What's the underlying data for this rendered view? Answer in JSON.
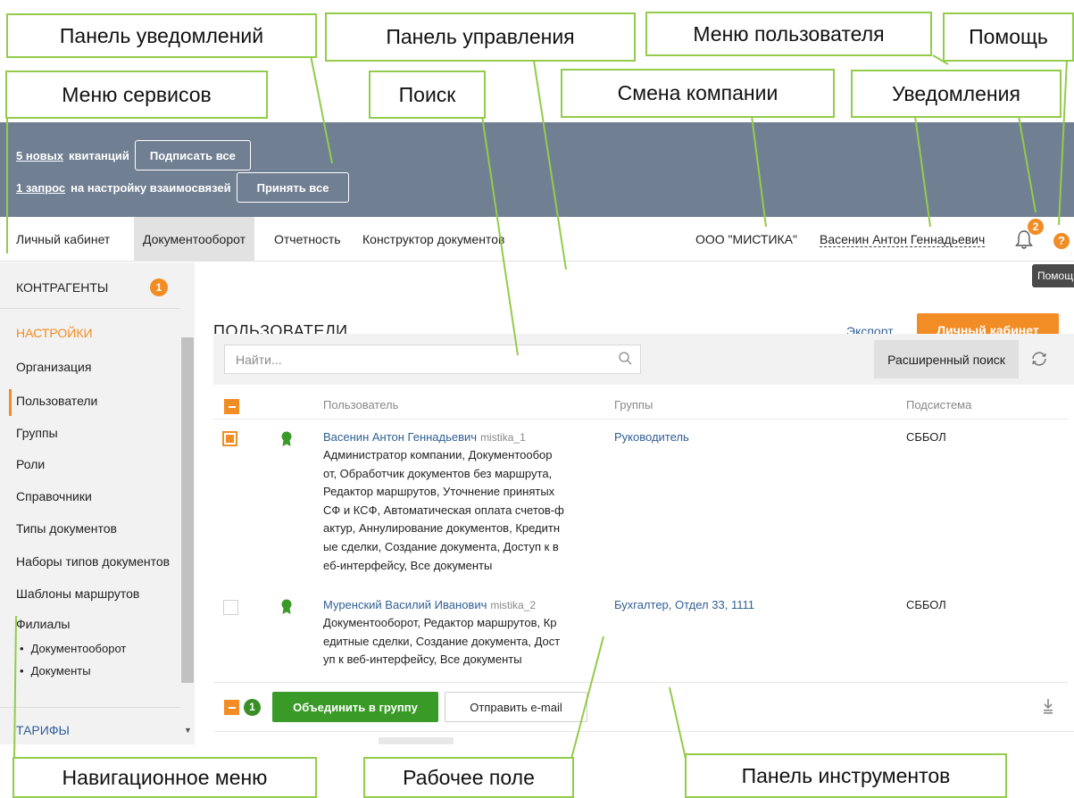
{
  "notifications": {
    "row1": {
      "link": "5 новых",
      "text": "квитанций",
      "button": "Подписать все"
    },
    "row2": {
      "link": "1 запрос",
      "text": "на настройку взаимосвязей",
      "button": "Принять все"
    }
  },
  "topnav": {
    "items": [
      "Личный кабинет",
      "Документооборот",
      "Отчетность",
      "Конструктор документов"
    ],
    "active_item": "Документооборот",
    "company": "ООО \"МИСТИКА\"",
    "user": "Васенин Антон Геннадьевич",
    "notification_count": "2",
    "help_symbol": "?",
    "help_tooltip": "Помощь"
  },
  "sidebar": {
    "counterparties": {
      "label": "КОНТРАГЕНТЫ",
      "badge": "1"
    },
    "settings": {
      "label": "НАСТРОЙКИ",
      "items": [
        "Организация",
        "Пользователи",
        "Группы",
        "Роли",
        "Справочники",
        "Типы документов",
        "Наборы типов документов",
        "Шаблоны маршрутов",
        "Филиалы"
      ],
      "active_item": "Пользователи",
      "sub_items": [
        "Документооборот",
        "Документы"
      ]
    },
    "tariffs": {
      "label": "ТАРИФЫ"
    }
  },
  "main": {
    "title": "ПОЛЬЗОВАТЕЛИ",
    "export_link": "Экспорт",
    "cabinet_button": "Личный кабинет",
    "search": {
      "placeholder": "Найти...",
      "value": ""
    },
    "advanced_search": "Расширенный поиск",
    "columns": [
      "Пользователь",
      "Группы",
      "Подсистема"
    ],
    "rows": [
      {
        "selected": true,
        "name": "Васенин Антон Геннадьевич",
        "login": "mistika_1",
        "roles": [
          "Администратор компании, Документообор",
          "от, Обработчик документов без маршрута,",
          "Редактор маршрутов, Уточнение принятых",
          "СФ и КСФ, Автоматическая оплата счетов-ф",
          "актур, Аннулирование документов, Кредитн",
          "ые сделки, Создание документа, Доступ к в",
          "еб-интерфейсу, Все документы"
        ],
        "groups": [
          "Руководитель"
        ],
        "subsystem": "СББОЛ"
      },
      {
        "selected": false,
        "name": "Муренский Василий Иванович",
        "login": "mistika_2",
        "roles": [
          "Документооборот, Редактор маршрутов, Кр",
          "едитные сделки, Создание документа, Дост",
          "уп к веб-интерфейсу, Все документы"
        ],
        "groups": [
          "Бухгалтер",
          "Отдел 33",
          "1111"
        ],
        "subsystem": "СББОЛ"
      }
    ],
    "bulk": {
      "selected_count": "1",
      "group_button": "Объединить в группу",
      "email_button": "Отправить e-mail"
    }
  },
  "annotations": {
    "notification_panel": "Панель уведомлений",
    "control_panel": "Панель управления",
    "user_menu": "Меню пользователя",
    "help": "Помощь",
    "services_menu": "Меню сервисов",
    "search": "Поиск",
    "company_switch": "Смена компании",
    "notifications": "Уведомления",
    "navigation_menu": "Навигационное меню",
    "work_area": "Рабочее поле",
    "toolbar": "Панель инструментов"
  },
  "colors": {
    "accent_orange": "#f28c25",
    "action_green": "#3a9a27",
    "link_blue": "#2f5f96",
    "panel_slate": "#717f92",
    "callout_border": "#92cc4a"
  },
  "icons": [
    "bell-icon",
    "help-icon",
    "search-icon",
    "refresh-icon",
    "medal-icon",
    "download-icon",
    "chevron-down-icon"
  ]
}
